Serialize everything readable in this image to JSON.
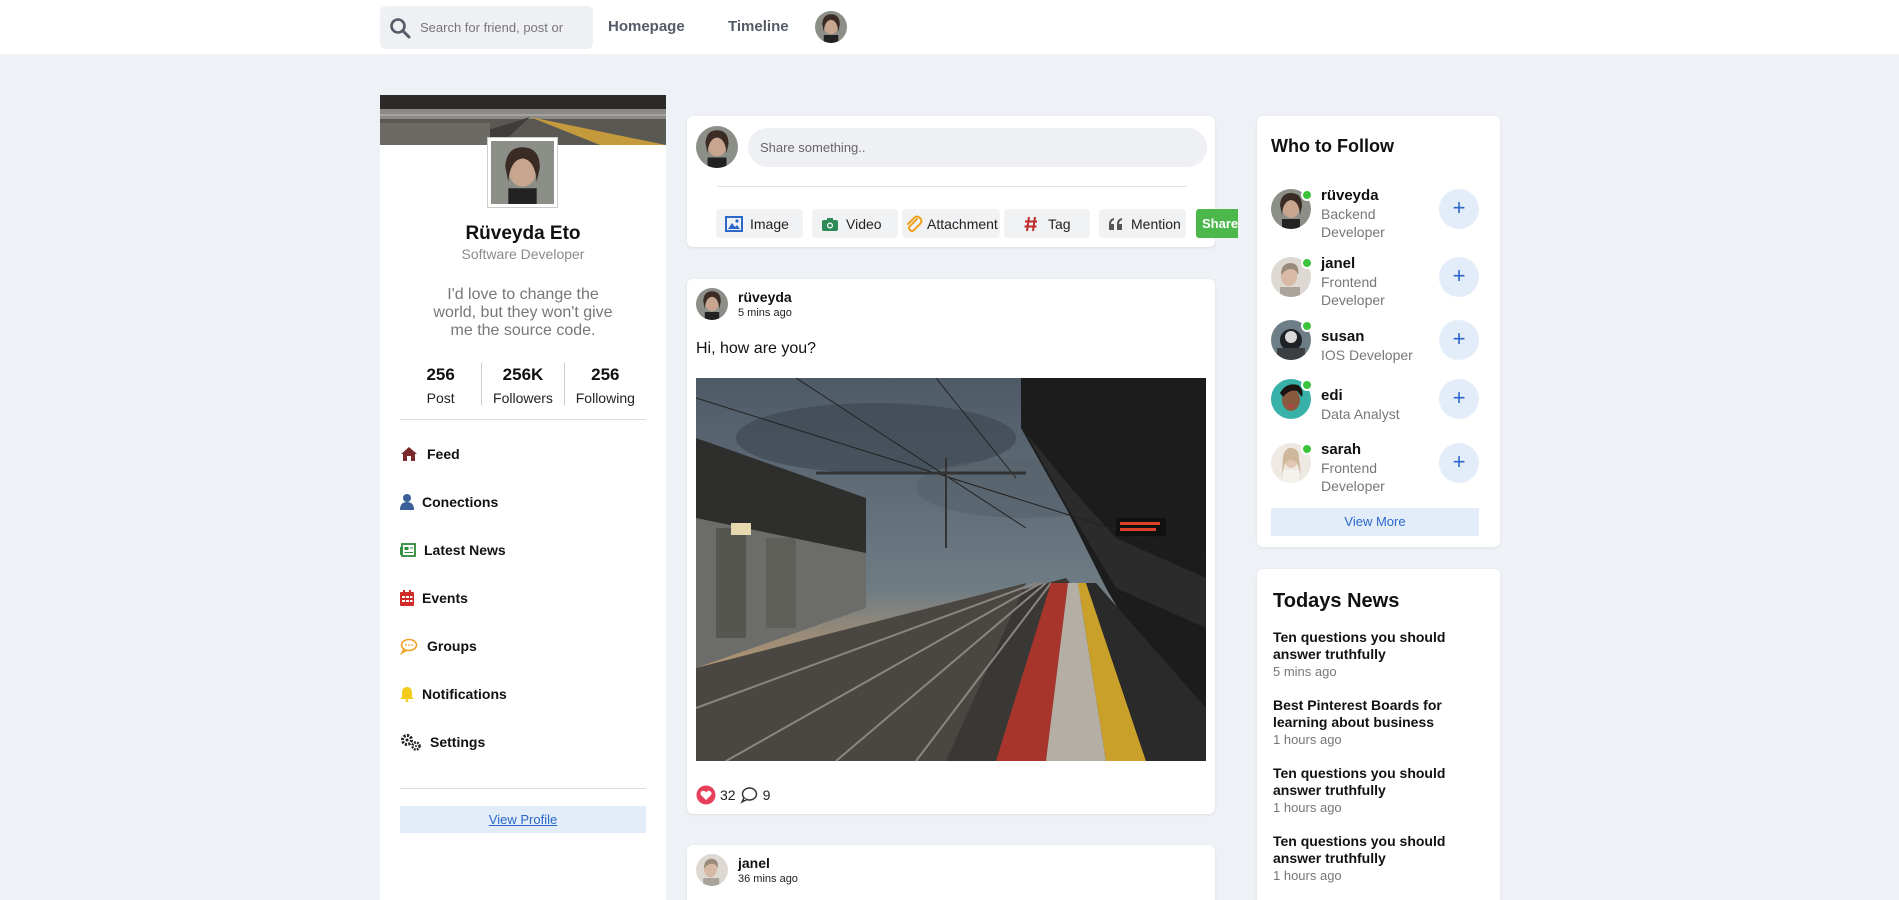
{
  "search": {
    "placeholder": "Search for friend, post or"
  },
  "nav": {
    "homepage": "Homepage",
    "timeline": "Timeline"
  },
  "profile": {
    "name": "Rüveyda Eto",
    "role": "Software Developer",
    "bio": "I'd love to change the world, but they won't give me the source code.",
    "stats": [
      {
        "value": "256",
        "label": "Post"
      },
      {
        "value": "256K",
        "label": "Followers"
      },
      {
        "value": "256",
        "label": "Following"
      }
    ],
    "menu": [
      {
        "label": "Feed",
        "icon": "home-icon"
      },
      {
        "label": "Conections",
        "icon": "user-icon"
      },
      {
        "label": "Latest News",
        "icon": "newspaper-icon"
      },
      {
        "label": "Events",
        "icon": "calendar-icon"
      },
      {
        "label": "Groups",
        "icon": "chat-bubbles-icon"
      },
      {
        "label": "Notifications",
        "icon": "bell-icon"
      },
      {
        "label": "Settings",
        "icon": "gears-icon"
      }
    ],
    "view_profile": "View Profile"
  },
  "share": {
    "placeholder": "Share something..",
    "buttons": [
      {
        "label": "Image",
        "icon": "image-icon"
      },
      {
        "label": "Video",
        "icon": "camera-icon"
      },
      {
        "label": "Attachment",
        "icon": "paperclip-icon"
      },
      {
        "label": "Tag",
        "icon": "hashtag-icon"
      },
      {
        "label": "Mention",
        "icon": "quote-icon"
      }
    ],
    "submit": "Share"
  },
  "posts": [
    {
      "user": "rüveyda",
      "time": "5 mins ago",
      "text": "Hi, how are you?",
      "likes": "32",
      "comments": "9"
    },
    {
      "user": "janel",
      "time": "36 mins ago"
    }
  ],
  "follow": {
    "title": "Who to Follow",
    "users": [
      {
        "name": "rüveyda",
        "role": "Backend Developer"
      },
      {
        "name": "janel",
        "role": "Frontend Developer"
      },
      {
        "name": "susan",
        "role": "IOS Developer"
      },
      {
        "name": "edi",
        "role": "Data Analyst"
      },
      {
        "name": "sarah",
        "role": "Frontend Developer"
      }
    ],
    "add_label": "+",
    "view_more": "View More"
  },
  "news": {
    "title": "Todays News",
    "items": [
      {
        "title": "Ten questions you should answer truthfully",
        "time": "5 mins ago"
      },
      {
        "title": "Best Pinterest Boards for learning about business",
        "time": "1 hours ago"
      },
      {
        "title": "Ten questions you should answer truthfully",
        "time": "1 hours ago"
      },
      {
        "title": "Ten questions you should answer truthfully",
        "time": "1 hours ago"
      }
    ]
  },
  "colors": {
    "accent": "#2a67c9",
    "accent_bg": "#e3edf9",
    "online": "#3bc43b",
    "share_green": "#4cb84c",
    "like": "#e8405a"
  }
}
